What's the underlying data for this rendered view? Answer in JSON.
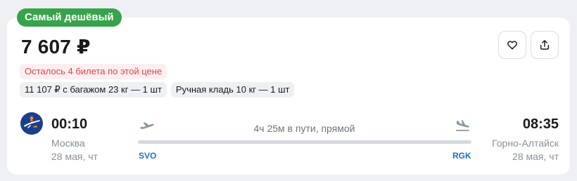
{
  "badge": {
    "label": "Самый дешёвый",
    "color": "#37a34a"
  },
  "price": "7 607 ₽",
  "actions": {
    "favorite_icon": "heart-icon",
    "share_icon": "share-icon"
  },
  "warning": "Осталось 4 билета по этой цене",
  "tags": [
    "11 107 ₽ с багажом 23 кг — 1 шт",
    "Ручная кладь 10 кг — 1 шт"
  ],
  "flight": {
    "airline_icon": "aeroflot-logo-icon",
    "departure": {
      "time": "00:10",
      "city": "Москва",
      "date": "28 мая, чт",
      "code": "SVO"
    },
    "arrival": {
      "time": "08:35",
      "city": "Горно-Алтайск",
      "date": "28 мая, чт",
      "code": "RGK"
    },
    "duration": "4ч 25м в пути, прямой"
  },
  "colors": {
    "accent": "#1a72c9",
    "warning_text": "#e2434b",
    "warning_bg": "#fdeff0"
  }
}
